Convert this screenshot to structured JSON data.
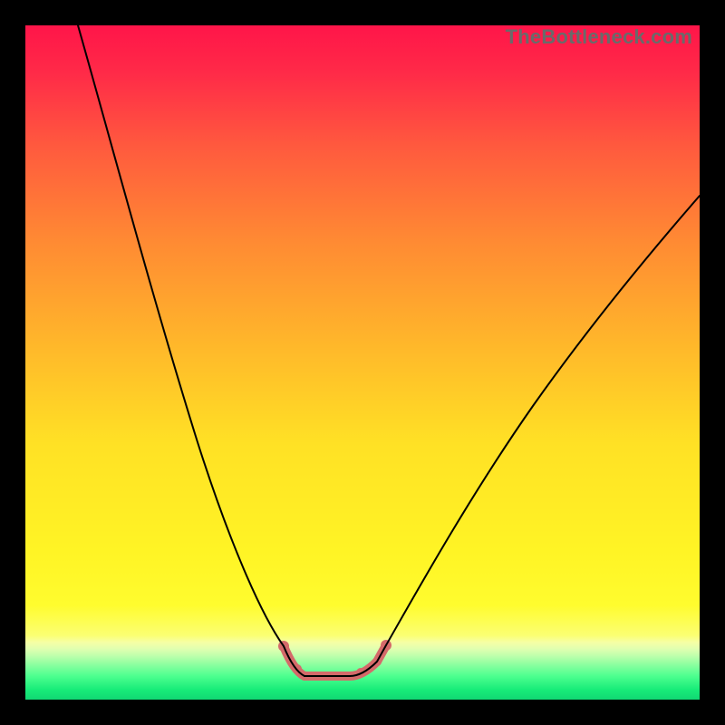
{
  "watermark": "TheBottleneck.com",
  "chart_data": {
    "type": "line",
    "title": "",
    "xlabel": "",
    "ylabel": "",
    "xlim": [
      0,
      100
    ],
    "ylim": [
      0,
      100
    ],
    "series": [
      {
        "name": "bottleneck-curve",
        "x": [
          8,
          14,
          20,
          26,
          32,
          38.3,
          41.4,
          45,
          48.1,
          52.2,
          53.5,
          58,
          66,
          75,
          85,
          95,
          100
        ],
        "y": [
          100,
          82,
          60,
          38,
          23,
          8,
          3.5,
          3.5,
          3.5,
          5.7,
          8,
          16,
          30,
          44,
          58,
          70,
          75
        ]
      }
    ],
    "highlight_range_x": [
      38.3,
      53.5
    ],
    "highlight_color": "#d46a6a",
    "background_gradient": {
      "top": "#ff1549",
      "mid_upper": "#ff8a33",
      "mid": "#ffe125",
      "mid_lower": "#fffc2e",
      "bottom": "#11d873"
    }
  }
}
